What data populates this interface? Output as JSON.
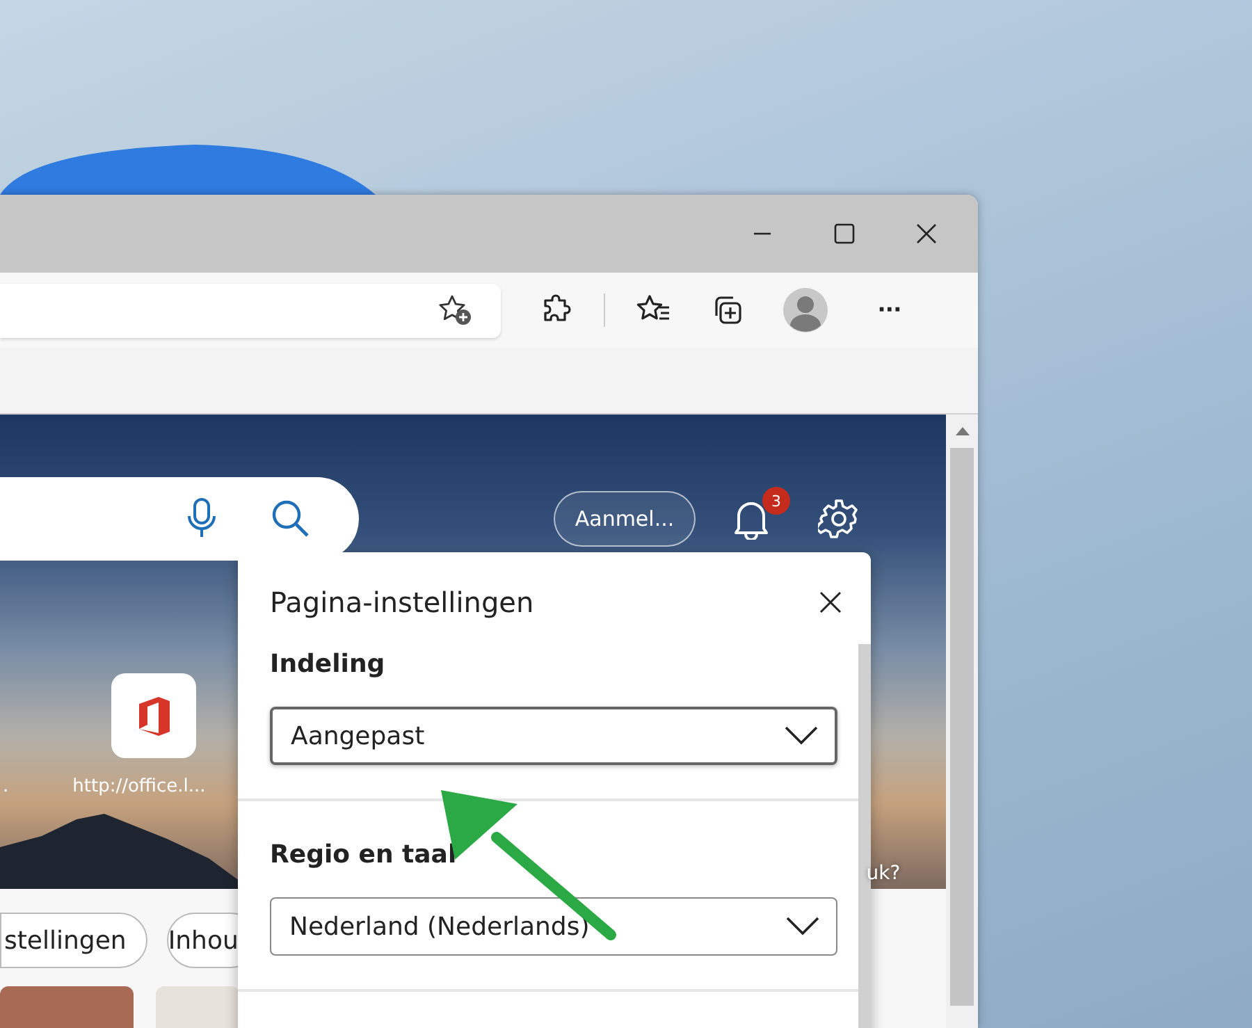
{
  "toolbar": {
    "more_label": "···"
  },
  "page": {
    "sign_in_button": "Aanmel...",
    "notification_count": "3",
    "shortcuts": [
      {
        "label": "."
      },
      {
        "label": "http://office.l..."
      }
    ],
    "hero_caption": "uk?",
    "chips": [
      "stellingen",
      "Inhou"
    ]
  },
  "settings_panel": {
    "title": "Pagina-instellingen",
    "sections": [
      {
        "heading": "Indeling",
        "value": "Aangepast",
        "focused": true
      },
      {
        "heading": "Regio en taal",
        "value": "Nederland (Nederlands)",
        "focused": false
      }
    ]
  }
}
